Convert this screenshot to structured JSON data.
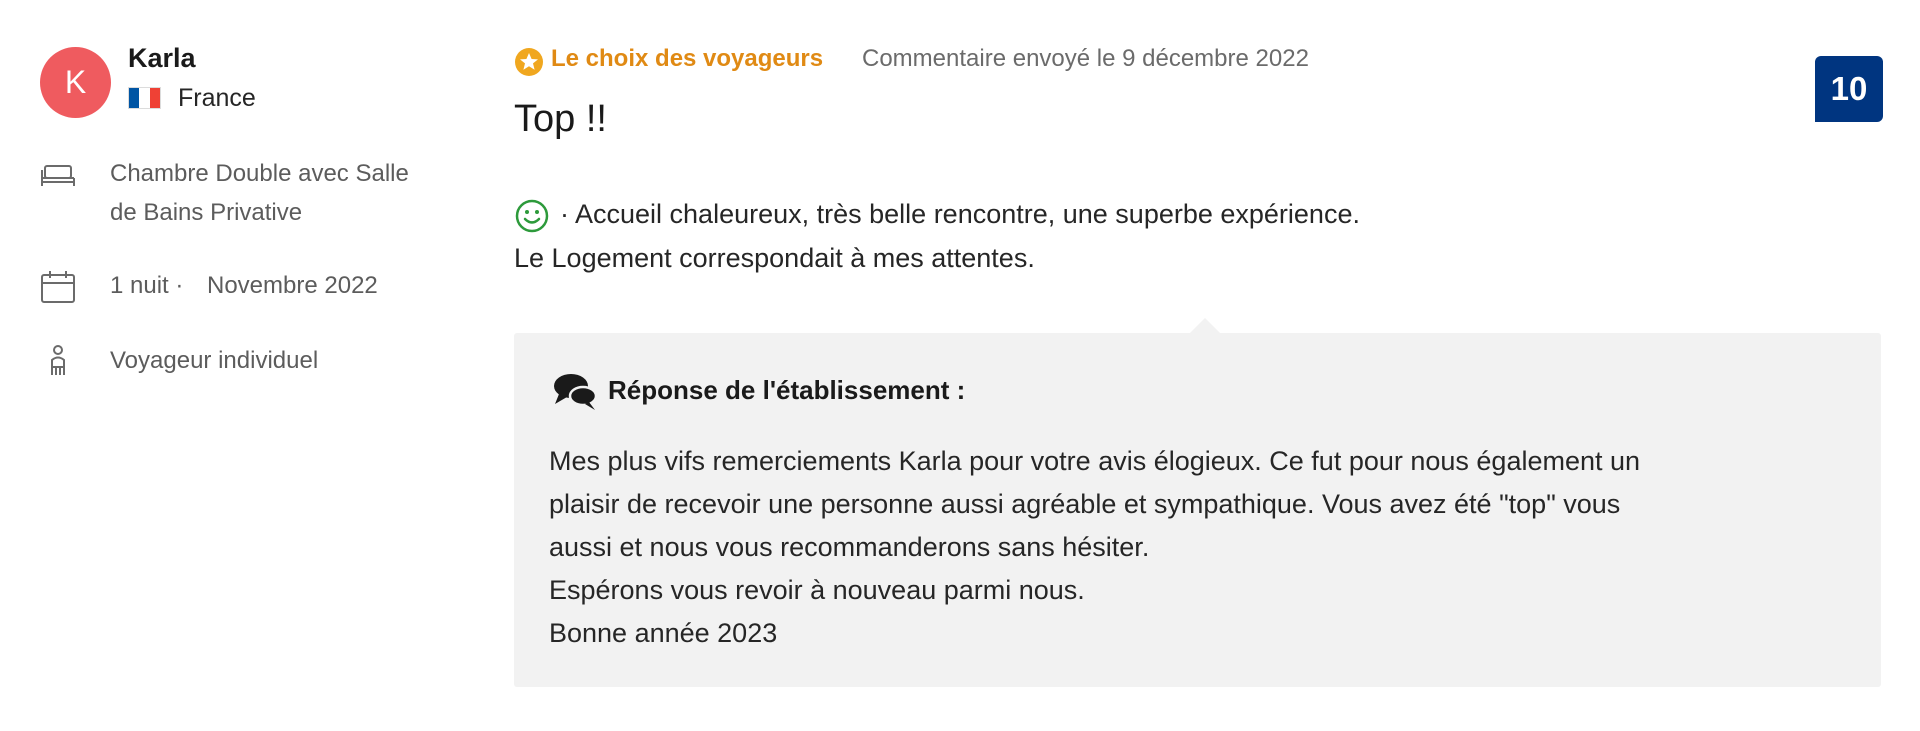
{
  "reviewer": {
    "initial": "K",
    "name": "Karla",
    "country": "France",
    "avatar_color": "#ef5b5f",
    "flag_colors": [
      "#0055a4",
      "#ffffff",
      "#ef4135"
    ]
  },
  "stay": {
    "room_line1": "Chambre Double avec Salle",
    "room_line2": "de Bains Privative",
    "nights": "1 nuit ·",
    "month": "Novembre 2022",
    "traveler_type": "Voyageur individuel",
    "icons": [
      "bed-icon",
      "calendar-icon",
      "person-icon"
    ]
  },
  "review": {
    "badge_label": "Le choix des voyageurs",
    "badge_color": "#e08a14",
    "sent_text": "Commentaire envoyé le 9 décembre 2022",
    "score": "10",
    "score_bg": "#003580",
    "title": "Top !!",
    "positive_line1": "· Accueil chaleureux, très belle rencontre, une superbe expérience.",
    "positive_line2": "Le Logement correspondait à mes attentes."
  },
  "response": {
    "heading": "Réponse de l'établissement :",
    "lines": [
      "Mes plus vifs remerciements Karla pour votre avis élogieux. Ce fut pour nous également un",
      "plaisir de recevoir une personne aussi agréable et sympathique. Vous avez été \"top\" vous",
      "aussi et nous vous recommanderons sans hésiter.",
      "Espérons vous revoir à nouveau parmi nous.",
      "Bonne année 2023"
    ]
  }
}
